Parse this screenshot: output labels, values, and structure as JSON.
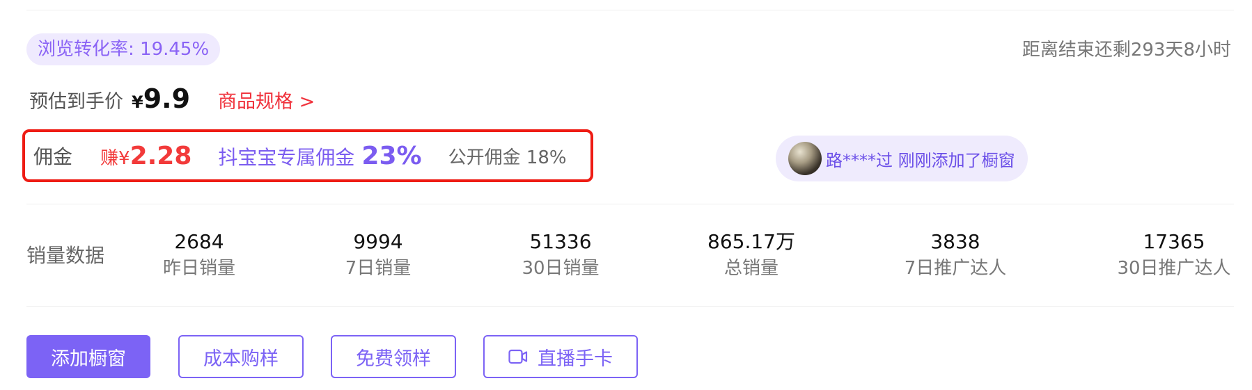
{
  "conversion": {
    "label": "浏览转化率: 19.45%"
  },
  "countdown": {
    "text": "距离结束还剩293天8小时"
  },
  "price": {
    "label": "预估到手价",
    "currency": "¥",
    "value": "9.9"
  },
  "spec_link": {
    "label": "商品规格 >"
  },
  "commission": {
    "label": "佣金",
    "earn_text": "赚¥",
    "earn_value": "2.28",
    "exclusive_label": "抖宝宝专属佣金",
    "exclusive_value": "23%",
    "public_label": "公开佣金 18%"
  },
  "activity": {
    "text": "路****过 刚刚添加了橱窗"
  },
  "sales": {
    "label": "销量数据",
    "stats": [
      {
        "value": "2684",
        "label": "昨日销量"
      },
      {
        "value": "9994",
        "label": "7日销量"
      },
      {
        "value": "51336",
        "label": "30日销量"
      },
      {
        "value": "865.17万",
        "label": "总销量"
      },
      {
        "value": "3838",
        "label": "7日推广达人"
      },
      {
        "value": "17365",
        "label": "30日推广达人"
      }
    ]
  },
  "actions": {
    "add_window": "添加橱窗",
    "cost_sample": "成本购样",
    "free_sample": "免费领样",
    "live_card": "直播手卡",
    "live_card_icon": "video-camera-icon"
  },
  "colors": {
    "accent": "#7c63f5",
    "red": "#f23a3a",
    "highlight_border": "#ee1c14"
  }
}
